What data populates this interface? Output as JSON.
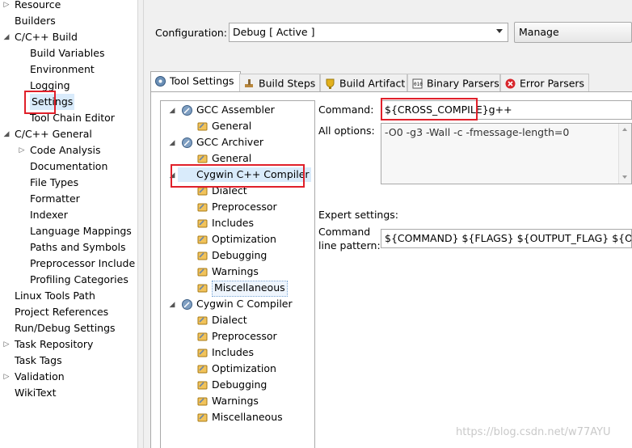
{
  "nav": {
    "items": [
      {
        "label": "Resource",
        "twisty": "collapsed"
      },
      {
        "label": "Builders"
      },
      {
        "label": "C/C++ Build",
        "twisty": "expanded"
      },
      {
        "label": "Build Variables"
      },
      {
        "label": "Environment"
      },
      {
        "label": "Logging"
      },
      {
        "label": "Settings"
      },
      {
        "label": "Tool Chain Editor"
      },
      {
        "label": "C/C++ General",
        "twisty": "expanded"
      },
      {
        "label": "Code Analysis",
        "twisty": "collapsed"
      },
      {
        "label": "Documentation"
      },
      {
        "label": "File Types"
      },
      {
        "label": "Formatter"
      },
      {
        "label": "Indexer"
      },
      {
        "label": "Language Mappings"
      },
      {
        "label": "Paths and Symbols"
      },
      {
        "label": "Preprocessor Include"
      },
      {
        "label": "Profiling Categories"
      },
      {
        "label": "Linux Tools Path"
      },
      {
        "label": "Project References"
      },
      {
        "label": "Run/Debug Settings"
      },
      {
        "label": "Task Repository",
        "twisty": "collapsed"
      },
      {
        "label": "Task Tags"
      },
      {
        "label": "Validation",
        "twisty": "collapsed"
      },
      {
        "label": "WikiText"
      }
    ]
  },
  "config": {
    "label": "Configuration:",
    "value": "Debug  [ Active ]",
    "manage_button": "Manage Configurations..."
  },
  "tabs": [
    {
      "label": "Tool Settings",
      "icon": "tool-settings-icon"
    },
    {
      "label": "Build Steps",
      "icon": "build-steps-icon"
    },
    {
      "label": "Build Artifact",
      "icon": "build-artifact-icon"
    },
    {
      "label": "Binary Parsers",
      "icon": "binary-parsers-icon"
    },
    {
      "label": "Error Parsers",
      "icon": "error-parsers-icon"
    }
  ],
  "tool_tree": [
    {
      "label": "GCC Assembler",
      "kind": "tool"
    },
    {
      "label": "General",
      "kind": "opt"
    },
    {
      "label": "GCC Archiver",
      "kind": "tool"
    },
    {
      "label": "General",
      "kind": "opt"
    },
    {
      "label": "Cygwin C++ Compiler",
      "kind": "tool"
    },
    {
      "label": "Dialect",
      "kind": "opt"
    },
    {
      "label": "Preprocessor",
      "kind": "opt"
    },
    {
      "label": "Includes",
      "kind": "opt"
    },
    {
      "label": "Optimization",
      "kind": "opt"
    },
    {
      "label": "Debugging",
      "kind": "opt"
    },
    {
      "label": "Warnings",
      "kind": "opt"
    },
    {
      "label": "Miscellaneous",
      "kind": "opt"
    },
    {
      "label": "Cygwin C Compiler",
      "kind": "tool"
    },
    {
      "label": "Dialect",
      "kind": "opt"
    },
    {
      "label": "Preprocessor",
      "kind": "opt"
    },
    {
      "label": "Includes",
      "kind": "opt"
    },
    {
      "label": "Optimization",
      "kind": "opt"
    },
    {
      "label": "Debugging",
      "kind": "opt"
    },
    {
      "label": "Warnings",
      "kind": "opt"
    },
    {
      "label": "Miscellaneous",
      "kind": "opt"
    }
  ],
  "settings": {
    "command_label": "Command:",
    "command_value": "${CROSS_COMPILE}g++",
    "all_options_label": "All options:",
    "all_options_value": "-O0 -g3 -Wall -c -fmessage-length=0",
    "expert_label": "Expert settings:",
    "pattern_label_1": "Command",
    "pattern_label_2": "line pattern:",
    "pattern_value": "${COMMAND} ${FLAGS} ${OUTPUT_FLAG} ${OUTPUT"
  },
  "watermark": "https://blog.csdn.net/w77AYU",
  "colors": {
    "highlight": "#e0202a",
    "selection": "#d9ebfb"
  }
}
